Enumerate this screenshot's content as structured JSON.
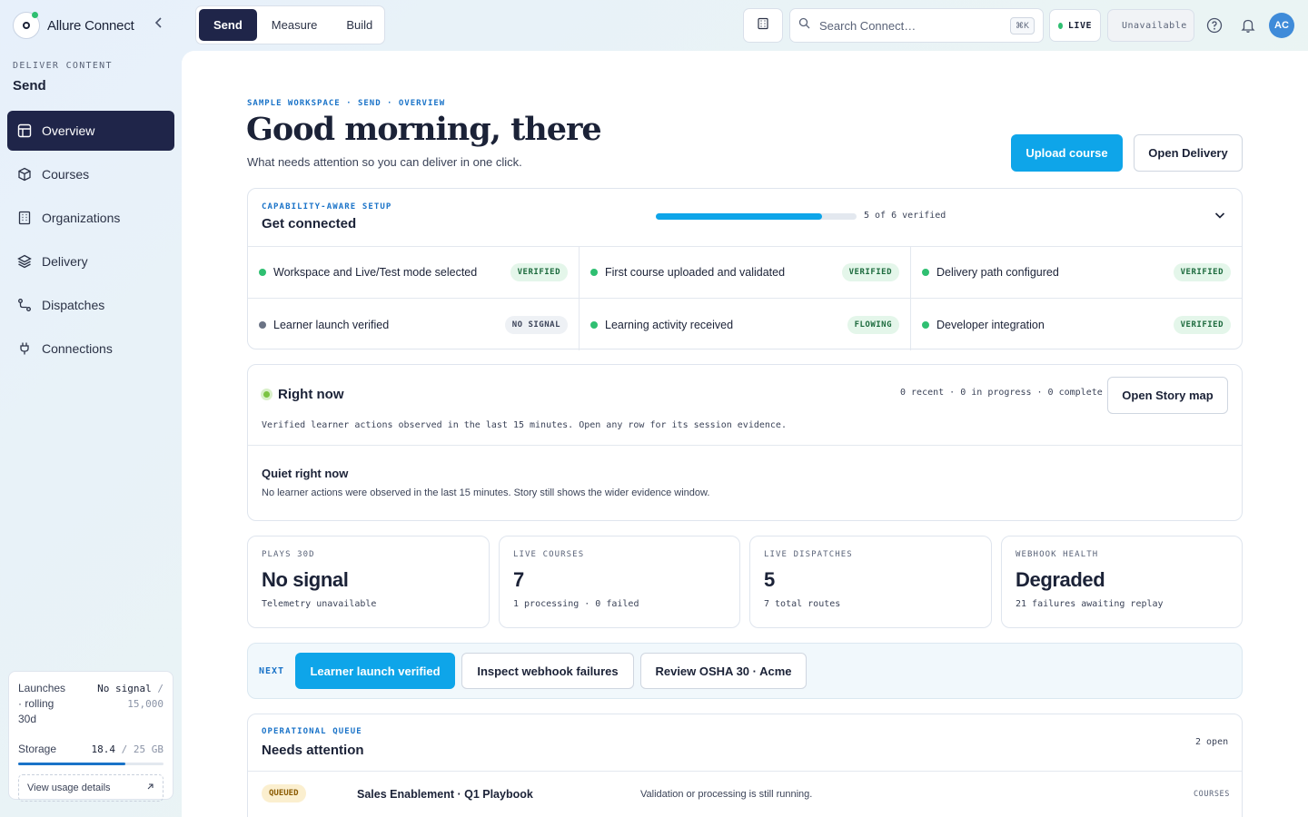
{
  "app": {
    "name": "Allure Connect"
  },
  "sidebar": {
    "section_label": "DELIVER CONTENT",
    "section_title": "Send",
    "items": [
      {
        "label": "Overview",
        "icon": "layout-icon",
        "active": true
      },
      {
        "label": "Courses",
        "icon": "cube-icon"
      },
      {
        "label": "Organizations",
        "icon": "building-icon"
      },
      {
        "label": "Delivery",
        "icon": "layers-icon"
      },
      {
        "label": "Dispatches",
        "icon": "route-icon"
      },
      {
        "label": "Connections",
        "icon": "plug-icon"
      }
    ],
    "usage": {
      "launches_label": "Launches · rolling 30d",
      "launches_value": "No signal",
      "launches_limit": "/ 15,000",
      "storage_label": "Storage",
      "storage_value": "18.4",
      "storage_limit": "/ 25 GB",
      "storage_fraction": 0.74,
      "link": "View usage details"
    }
  },
  "topbar": {
    "modes": [
      "Send",
      "Measure",
      "Build"
    ],
    "active_mode": "Send",
    "search_placeholder": "Search Connect…",
    "search_shortcut": "⌘K",
    "live_label": "LIVE",
    "unavailable_label": "Unavailable",
    "avatar_initials": "AC"
  },
  "page": {
    "breadcrumb": "SAMPLE WORKSPACE · SEND · OVERVIEW",
    "greeting": "Good morning, there",
    "subtitle": "What needs attention so you can deliver in one click.",
    "primary_action": "Upload course",
    "secondary_action": "Open Delivery"
  },
  "setup": {
    "eyebrow": "CAPABILITY-AWARE SETUP",
    "title": "Get connected",
    "progress_label": "5 of 6 verified",
    "progress_fraction": 0.83,
    "steps": [
      {
        "label": "Workspace and Live/Test mode selected",
        "status": "VERIFIED",
        "state": "ok"
      },
      {
        "label": "First course uploaded and validated",
        "status": "VERIFIED",
        "state": "ok"
      },
      {
        "label": "Delivery path configured",
        "status": "VERIFIED",
        "state": "ok"
      },
      {
        "label": "Learner launch verified",
        "status": "NO SIGNAL",
        "state": "none"
      },
      {
        "label": "Learning activity received",
        "status": "FLOWING",
        "state": "ok"
      },
      {
        "label": "Developer integration",
        "status": "VERIFIED",
        "state": "ok"
      }
    ]
  },
  "right_now": {
    "title": "Right now",
    "counts": "0 recent · 0 in progress · 0 complete",
    "action": "Open Story map",
    "description": "Verified learner actions observed in the last 15 minutes. Open any row for its session evidence.",
    "empty_title": "Quiet right now",
    "empty_text": "No learner actions were observed in the last 15 minutes. Story still shows the wider evidence window."
  },
  "kpis": [
    {
      "label": "PLAYS 30D",
      "value": "No signal",
      "sub": "Telemetry unavailable"
    },
    {
      "label": "LIVE COURSES",
      "value": "7",
      "sub": "1 processing · 0 failed"
    },
    {
      "label": "LIVE DISPATCHES",
      "value": "5",
      "sub": "7 total routes"
    },
    {
      "label": "WEBHOOK HEALTH",
      "value": "Degraded",
      "sub": "21 failures awaiting replay"
    }
  ],
  "next": {
    "label": "NEXT",
    "actions": [
      "Learner launch verified",
      "Inspect webhook failures",
      "Review OSHA 30 · Acme"
    ]
  },
  "queue": {
    "eyebrow": "OPERATIONAL QUEUE",
    "title": "Needs attention",
    "count": "2 open",
    "rows": [
      {
        "status": "QUEUED",
        "name": "Sales Enablement · Q1 Playbook",
        "note": "Validation or processing is still running.",
        "area": "COURSES"
      }
    ]
  },
  "colors": {
    "accent": "#0ea5e9",
    "nav_active": "#1f2549",
    "verified_bg": "#e4f6ea",
    "status_green": "#2fbf71"
  }
}
